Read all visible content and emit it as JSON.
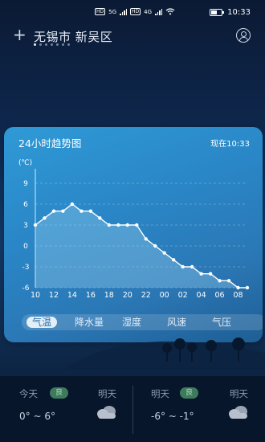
{
  "status_bar": {
    "sim1": "HD",
    "sim2": "HD",
    "net1": "5G",
    "net2": "4G",
    "time": "10:33"
  },
  "header": {
    "add_icon": "plus-icon",
    "location": "无锡市 新吴区",
    "account_icon": "user-circle-icon",
    "page_count": 7,
    "active_page": 1
  },
  "card": {
    "title": "24小时趋势图",
    "now_label": "现在10:33",
    "tabs": [
      {
        "label": "气温",
        "active": true
      },
      {
        "label": "降水量",
        "active": false
      },
      {
        "label": "湿度",
        "active": false
      },
      {
        "label": "风速",
        "active": false
      },
      {
        "label": "气压",
        "active": false
      }
    ]
  },
  "chart_data": {
    "type": "line",
    "ylabel": "(℃)",
    "ylim": [
      -6,
      9
    ],
    "y_ticks": [
      "9",
      "6",
      "3",
      "0",
      "-3",
      "-6"
    ],
    "x_tick_labels": [
      "10",
      "12",
      "14",
      "16",
      "18",
      "20",
      "22",
      "00",
      "02",
      "04",
      "06",
      "08"
    ],
    "series": [
      {
        "values": [
          3,
          4,
          5,
          5,
          6,
          5,
          5,
          4,
          3,
          3,
          3,
          3,
          1,
          0,
          -1,
          -2,
          -3,
          -3,
          -4,
          -4,
          -5,
          -5,
          -6,
          -6
        ]
      }
    ],
    "line_color": "#ffffff",
    "fill_color": "#9fd4f2"
  },
  "today": {
    "today_label": "今天",
    "today_aqi": "良",
    "today_weather_label": "明天",
    "today_temp": "0° ~ 6°",
    "today_icon": "cloudy-icon"
  },
  "tomorrow": {
    "label": "明天",
    "aqi": "良",
    "weather_label": "明天",
    "temp": "-6° ~ -1°",
    "icon": "cloudy-icon"
  }
}
